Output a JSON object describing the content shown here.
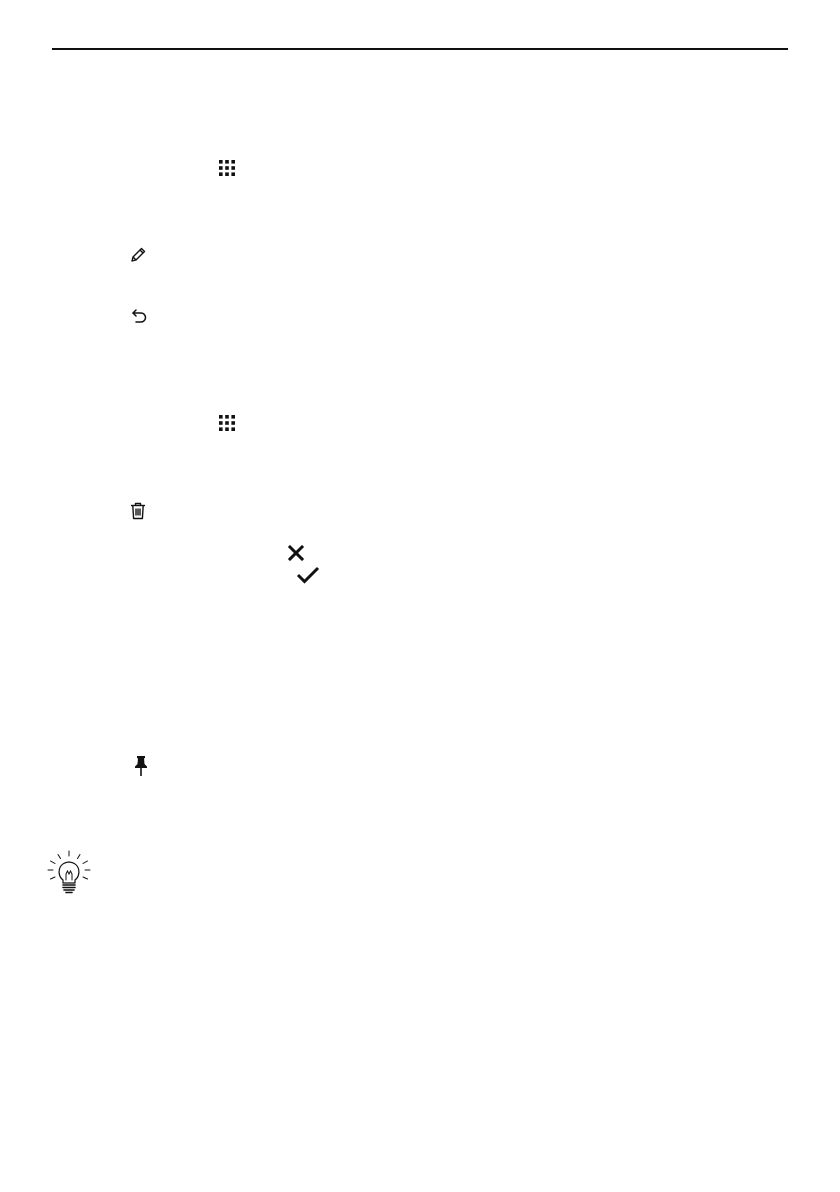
{
  "page": {
    "header_rule": true
  },
  "icons": [
    {
      "key": "grid-1",
      "name": "app-grid-icon"
    },
    {
      "key": "pencil",
      "name": "pencil-edit-icon"
    },
    {
      "key": "undo",
      "name": "undo-arrow-icon"
    },
    {
      "key": "grid-2",
      "name": "app-grid-icon"
    },
    {
      "key": "trash",
      "name": "trash-delete-icon"
    },
    {
      "key": "close",
      "name": "close-x-icon"
    },
    {
      "key": "check",
      "name": "checkmark-icon"
    },
    {
      "key": "pin",
      "name": "pushpin-icon"
    },
    {
      "key": "bulb",
      "name": "lightbulb-tip-icon"
    }
  ]
}
